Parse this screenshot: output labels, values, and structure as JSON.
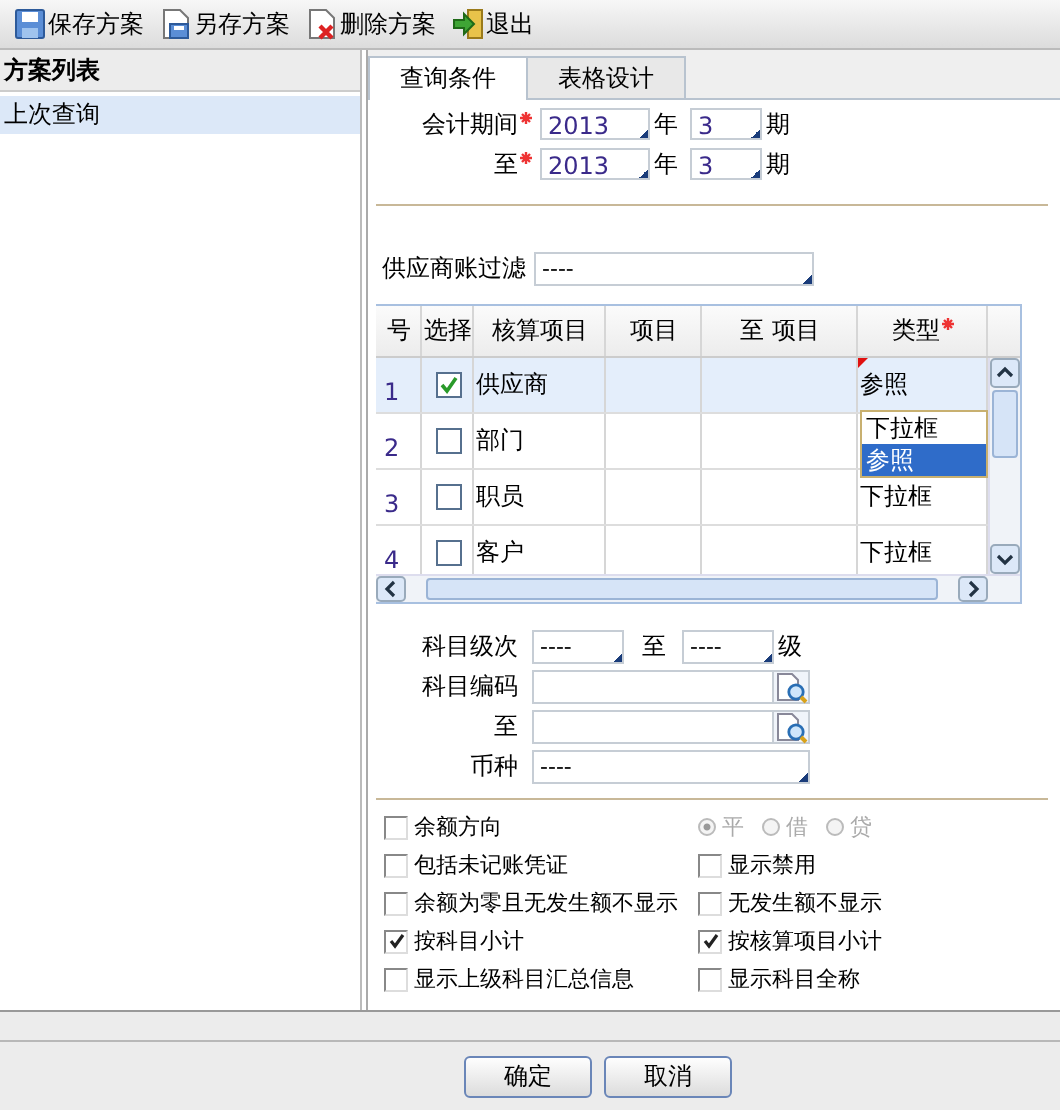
{
  "toolbar": [
    {
      "kind": "save",
      "label": "保存方案"
    },
    {
      "kind": "save_as",
      "label": "另存方案"
    },
    {
      "kind": "delete",
      "label": "删除方案"
    },
    {
      "kind": "exit",
      "label": "退出"
    }
  ],
  "scheme_list": {
    "title": "方案列表",
    "items": [
      {
        "label": "上次查询",
        "selected": true
      }
    ]
  },
  "tabs": [
    {
      "label": "查询条件",
      "selected": true
    },
    {
      "label": "表格设计",
      "selected": false
    }
  ],
  "period_rows": [
    {
      "label": "会计期间",
      "required": true,
      "year": "2013",
      "year_unit": "年",
      "period": "3",
      "period_unit": "期"
    },
    {
      "label": "至",
      "required": true,
      "year": "2013",
      "year_unit": "年",
      "period": "3",
      "period_unit": "期"
    }
  ],
  "supplier_filter": {
    "label": "供应商账过滤",
    "value": "----"
  },
  "grid": {
    "columns": [
      {
        "label": "号",
        "required": false
      },
      {
        "label": "选择",
        "required": false
      },
      {
        "label": "核算项目",
        "required": false
      },
      {
        "label": "项目",
        "required": false
      },
      {
        "label": "至 项目",
        "required": false
      },
      {
        "label": "类型",
        "required": true
      }
    ],
    "rows": [
      {
        "index": "1",
        "checked": true,
        "item": "供应商",
        "type": "参照",
        "flagged": true,
        "selected": true
      },
      {
        "index": "2",
        "checked": false,
        "item": "部门",
        "flagged": false,
        "selected": false,
        "dropdown": [
          {
            "label": "下拉框",
            "selected": false
          },
          {
            "label": "参照",
            "selected": true
          }
        ]
      },
      {
        "index": "3",
        "checked": false,
        "item": "职员",
        "type": "下拉框",
        "flagged": false,
        "selected": false
      },
      {
        "index": "4",
        "checked": false,
        "item": "客户",
        "type": "下拉框",
        "flagged": false,
        "selected": false
      }
    ]
  },
  "level": {
    "label": "科目级次",
    "from": "----",
    "to_label": "至",
    "to": "----",
    "unit": "级"
  },
  "account_code": {
    "label": "科目编码",
    "to_label": "至"
  },
  "currency": {
    "label": "币种",
    "value": "----"
  },
  "options": [
    {
      "kind": "checkbox",
      "label": "余额方向",
      "checked": false
    },
    {
      "kind": "radio_group",
      "disabled": true,
      "choices": [
        {
          "label": "平",
          "selected": true
        },
        {
          "label": "借",
          "selected": false
        },
        {
          "label": "贷",
          "selected": false
        }
      ]
    },
    {
      "kind": "checkbox",
      "label": "包括未记账凭证",
      "checked": false
    },
    {
      "kind": "checkbox",
      "label": "显示禁用",
      "checked": false
    },
    {
      "kind": "checkbox",
      "label": "余额为零且无发生额不显示",
      "checked": false
    },
    {
      "kind": "checkbox",
      "label": "无发生额不显示",
      "checked": false
    },
    {
      "kind": "checkbox",
      "label": "按科目小计",
      "checked": true
    },
    {
      "kind": "checkbox",
      "label": "按核算项目小计",
      "checked": true
    },
    {
      "kind": "checkbox",
      "label": "显示上级科目汇总信息",
      "checked": false
    },
    {
      "kind": "checkbox",
      "label": "显示科目全称",
      "checked": false
    }
  ],
  "buttons": [
    {
      "label": "确定"
    },
    {
      "label": "取消"
    }
  ]
}
